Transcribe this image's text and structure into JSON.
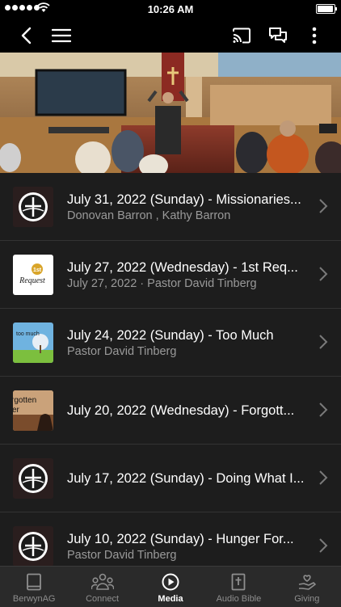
{
  "status_bar": {
    "time": "10:26 AM"
  },
  "media_list": [
    {
      "title": "July 31, 2022 (Sunday) - Missionaries...",
      "subtitle": "Donovan Barron  , Kathy Barron",
      "thumb": "church-logo"
    },
    {
      "title": "July 27, 2022 (Wednesday) - 1st Req...",
      "subtitle": "July 27, 2022 · Pastor David Tinberg",
      "thumb": "1st-request",
      "thumb_text": "Request",
      "thumb_badge": "1st"
    },
    {
      "title": "July 24, 2022 (Sunday) - Too Much",
      "subtitle": "Pastor David Tinberg",
      "thumb": "too-much",
      "thumb_text": "too much"
    },
    {
      "title": "July 20, 2022 (Wednesday) - Forgott...",
      "subtitle": "",
      "thumb": "forgotten",
      "thumb_text_top": "rgotten",
      "thumb_text_bottom": "er"
    },
    {
      "title": "July 17, 2022 (Sunday) - Doing What I...",
      "subtitle": "",
      "thumb": "church-logo"
    },
    {
      "title": "July 10, 2022 (Sunday) - Hunger For...",
      "subtitle": "Pastor David Tinberg",
      "thumb": "church-logo"
    }
  ],
  "tabs": [
    {
      "label": "BerwynAG",
      "icon": "book-icon",
      "active": false
    },
    {
      "label": "Connect",
      "icon": "people-icon",
      "active": false
    },
    {
      "label": "Media",
      "icon": "play-circle-icon",
      "active": true
    },
    {
      "label": "Audio Bible",
      "icon": "bible-icon",
      "active": false
    },
    {
      "label": "Giving",
      "icon": "giving-hand-icon",
      "active": false
    }
  ],
  "colors": {
    "background": "#1d1d1d",
    "bar": "#000000",
    "tab_bar": "#2a2a2a",
    "inactive": "#8e8e8e",
    "subtitle": "#9a9a9a"
  }
}
